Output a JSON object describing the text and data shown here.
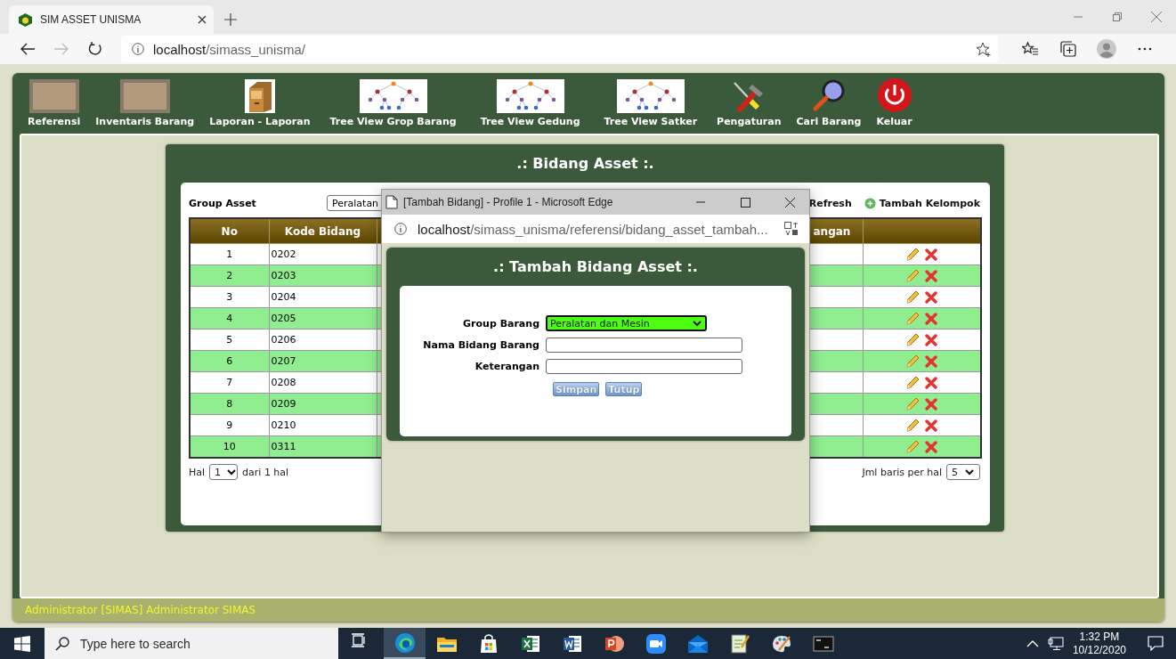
{
  "browser": {
    "tab_title": "SIM ASSET UNISMA",
    "url_host": "localhost",
    "url_path": "/simass_unisma/"
  },
  "menu": [
    {
      "label": "Referensi",
      "kind": "photo"
    },
    {
      "label": "Inventaris Barang",
      "kind": "photo"
    },
    {
      "label": "Laporan - Laporan",
      "kind": "cabinet"
    },
    {
      "label": "Tree View Grop Barang",
      "kind": "tree"
    },
    {
      "label": "Tree View Gedung",
      "kind": "tree"
    },
    {
      "label": "Tree View Satker",
      "kind": "tree"
    },
    {
      "label": "Pengaturan",
      "kind": "tools"
    },
    {
      "label": "Cari Barang",
      "kind": "search"
    },
    {
      "label": "Keluar",
      "kind": "power"
    }
  ],
  "panel": {
    "title": ".: Bidang Asset :.",
    "group_label": "Group Asset",
    "group_value": "Peralatan",
    "actions": [
      {
        "label": "Refresh",
        "kind": "refresh"
      },
      {
        "label": "Tambah Kelompok",
        "kind": "add"
      }
    ]
  },
  "table": {
    "columns": [
      "No",
      "Kode Bidang",
      "angan"
    ],
    "rows": [
      {
        "no": "1",
        "kode": "0202"
      },
      {
        "no": "2",
        "kode": "0203"
      },
      {
        "no": "3",
        "kode": "0204"
      },
      {
        "no": "4",
        "kode": "0205"
      },
      {
        "no": "5",
        "kode": "0206"
      },
      {
        "no": "6",
        "kode": "0207"
      },
      {
        "no": "7",
        "kode": "0208"
      },
      {
        "no": "8",
        "kode": "0209"
      },
      {
        "no": "9",
        "kode": "0210"
      },
      {
        "no": "10",
        "kode": "0311"
      }
    ]
  },
  "pager": {
    "page_label": "Hal",
    "page": "1",
    "page_total": "dari 1 hal",
    "rows_label": "Jml baris per hal",
    "rows_value": "5"
  },
  "popup": {
    "title": "[Tambah Bidang] - Profile 1 - Microsoft Edge",
    "url_host": "localhost",
    "url_path": "/simass_unisma/referensi/bidang_asset_tambah...",
    "heading": ".: Tambah Bidang Asset :.",
    "fields": [
      {
        "label": "Group Barang",
        "kind": "select",
        "value": "Peralatan dan Mesin"
      },
      {
        "label": "Nama Bidang Barang",
        "kind": "text"
      },
      {
        "label": "Keterangan",
        "kind": "text"
      }
    ],
    "buttons": [
      "Simpan",
      "Tutup"
    ]
  },
  "footer": "Administrator [SIMAS] Administrator SIMAS",
  "taskbar": {
    "search_placeholder": "Type here to search",
    "apps": [
      {
        "kind": "taskview",
        "selected": false
      },
      {
        "kind": "edge",
        "selected": true
      },
      {
        "kind": "explorer",
        "selected": false
      },
      {
        "kind": "store",
        "selected": false
      },
      {
        "kind": "excel",
        "selected": false
      },
      {
        "kind": "word",
        "selected": false
      },
      {
        "kind": "powerpoint",
        "selected": false
      },
      {
        "kind": "zoom",
        "selected": false
      },
      {
        "kind": "mail",
        "selected": false
      },
      {
        "kind": "notepad",
        "selected": false
      },
      {
        "kind": "paint",
        "selected": false
      },
      {
        "kind": "cmd",
        "selected": false
      }
    ],
    "time": "1:32 PM",
    "date": "10/12/2020"
  }
}
